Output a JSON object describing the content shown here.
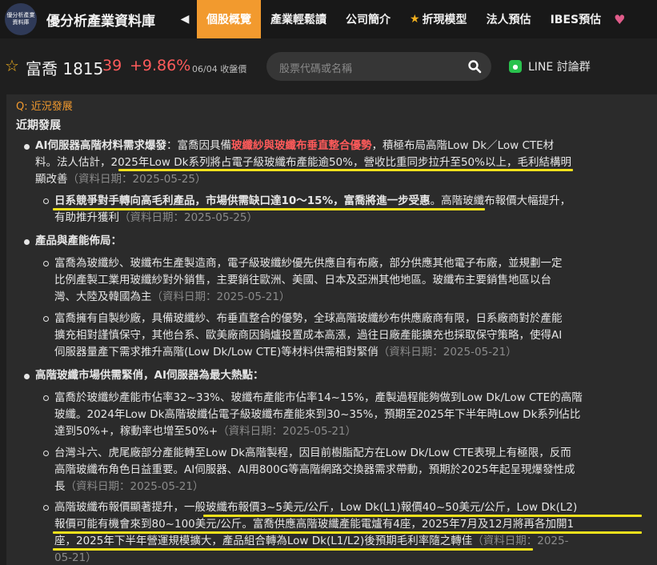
{
  "nav": {
    "logo_text": "優分析產業資料庫",
    "brand": "優分析產業資料庫",
    "left_arrow": "◀",
    "tabs": [
      {
        "label": "個股概覽"
      },
      {
        "label": "產業輕鬆讀"
      },
      {
        "label": "公司簡介"
      },
      {
        "label": "折現模型"
      },
      {
        "label": "法人預估"
      },
      {
        "label": "IBES預估"
      }
    ]
  },
  "quote": {
    "name": "富喬 1815",
    "price": "39",
    "change": "+9.86%",
    "date": "06/04 收盤價"
  },
  "search": {
    "placeholder": "股票代碼或名稱"
  },
  "line_group": {
    "label": "LINE 討論群"
  },
  "panel": {
    "question": "Q: 近況發展",
    "subtitle": "近期發展",
    "s1": {
      "title": "AI伺服器高階材料需求爆發",
      "l1a": "：富喬因具備",
      "l1hl": "玻纖紗與玻纖布垂直整合優勢",
      "l1b": "，積極布局高階Low Dk／Low CTE材",
      "l2a": "料。法人估計，",
      "l2b": "2025年Low Dk系列將占電子級玻纖布產能逾50%，營收比重同步拉升至50%以上",
      "l2c": "，毛利結構明",
      "l3a": "顯改善",
      "l3d": "（資料日期：2025-05-25）",
      "c1a": "日系競爭對手轉向高毛利產品，市場供需缺口達10～15%，富喬將進一步受惠",
      "c1b": "。高階玻纖布報價大幅提升，",
      "c2a": "有助推升獲利",
      "c2d": "（資料日期：2025-05-25）"
    },
    "s2": {
      "title": "產品與產能佈局：",
      "a1": "富喬為玻纖紗、玻纖布生產製造商，電子級玻纖紗優先供應自有布廠，部分供應其他電子布廠，並規劃一定",
      "a2": "比例產製工業用玻纖紗對外銷售，主要銷往歐洲、美國、日本及亞洲其他地區。玻纖布主要銷售地區以台",
      "a3a": "灣、大陸及韓國為主",
      "a3d": "（資料日期：2025-05-21）",
      "b1": "富喬擁有自製紗廠，具備玻纖紗、布垂直整合的優勢，全球高階玻纖紗布供應廠商有限，日系廠商對於產能",
      "b2": "擴充相對謹慎保守，其他台系、歐美廠商因鍋爐投置成本高漲，過往日廠產能擴充也採取保守策略，使得AI",
      "b3a": "伺服器量產下需求推升高階(Low Dk/Low CTE)等材料供需相對緊俏",
      "b3d": "（資料日期：2025-05-21）"
    },
    "s3": {
      "title": "高階玻纖市場供需緊俏，AI伺服器為最大熱點：",
      "a1": "富喬於玻纖紗產能市佔率32~33%、玻纖布產能市佔率14~15%，產製過程能夠做到Low Dk/Low CTE的高階",
      "a2": "玻纖。2024年Low Dk高階玻纖佔電子級玻纖布產能來到30~35%，預期至2025年下半年時Low Dk系列佔比",
      "a3a": "達到50%+，稼動率也增至50%+",
      "a3d": "（資料日期：2025-05-21）",
      "b1": "台灣斗六、虎尾廠部分產能轉至Low Dk高階製程，因目前樹脂配方在Low Dk/Low CTE表現上有極限，反而",
      "b2": "高階玻纖布角色日益重要。AI伺服器、AI用800G等高階網路交換器需求帶動，預期於2025年起呈現爆發性成",
      "b3a": "長",
      "b3d": "（資料日期：2025-05-21）",
      "c1a": "高階玻纖布報價顯著提升，",
      "c1b": "一般玻纖布報價3~5美元/公斤，Low Dk(L1)報價40~50美元/公斤，Low Dk(L2)",
      "c2a": "報價可能有機會來到80~100美元/公斤",
      "c2b": "。富喬供應高階玻纖產能電爐有4座，2025年7月及12月將再各加開1",
      "c3a": "座，2025年下半年營運規模擴大，產品組合轉為Low Dk(L1/L2)後預期毛利率隨之轉佳",
      "c3d": "（資料日期：2025-",
      "c4d": "05-21）"
    }
  }
}
